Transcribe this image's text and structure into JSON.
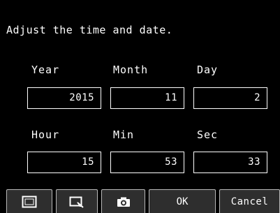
{
  "instruction": "Adjust the time and date.",
  "labels": {
    "year": "Year",
    "month": "Month",
    "day": "Day",
    "hour": "Hour",
    "min": "Min",
    "sec": "Sec"
  },
  "values": {
    "year": "2015",
    "month": "11",
    "day": "2",
    "hour": "15",
    "min": "53",
    "sec": "33"
  },
  "toolbar": {
    "buttons": [
      {
        "icon": "fullscreen-frame-icon"
      },
      {
        "icon": "zoom-window-icon"
      },
      {
        "icon": "camera-icon"
      }
    ],
    "ok_label": "OK",
    "cancel_label": "Cancel"
  }
}
